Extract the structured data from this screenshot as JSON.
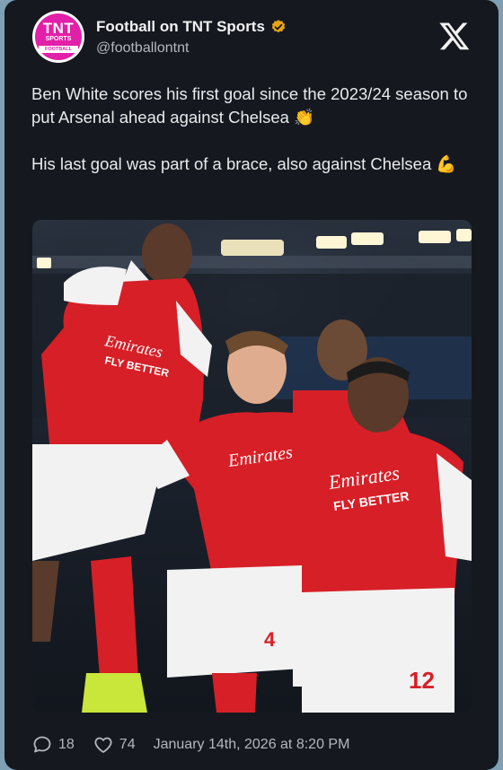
{
  "account": {
    "avatar_text": {
      "line1": "TNT",
      "line2": "SPORTS",
      "line3": "FOOTBALL"
    },
    "name": "Football on TNT Sports",
    "handle": "@footballontnt",
    "verified": true
  },
  "post": {
    "paragraph1": "Ben White scores his first goal since the 2023/24 season to put Arsenal ahead against Chelsea 👏",
    "paragraph2": "His last goal was part of a brace, also against Chelsea 💪",
    "image_shirt_sponsor_line1": "Emirates",
    "image_shirt_sponsor_line2": "FLY BETTER",
    "image_shirt_number_left": "4",
    "image_shirt_number_right": "12"
  },
  "footer": {
    "replies": "18",
    "likes": "74",
    "timestamp": "January 14th, 2026 at 8:20 PM"
  },
  "icons": {
    "verified": "verified-badge-icon",
    "logo": "x-logo-icon",
    "reply": "reply-bubble-icon",
    "like": "heart-icon"
  },
  "colors": {
    "card_bg": "#15191f",
    "backdrop": "#7fa0b4",
    "brand_pink": "#e21fa8",
    "verified_gold": "#e8a317",
    "kit_red": "#d71f27"
  }
}
